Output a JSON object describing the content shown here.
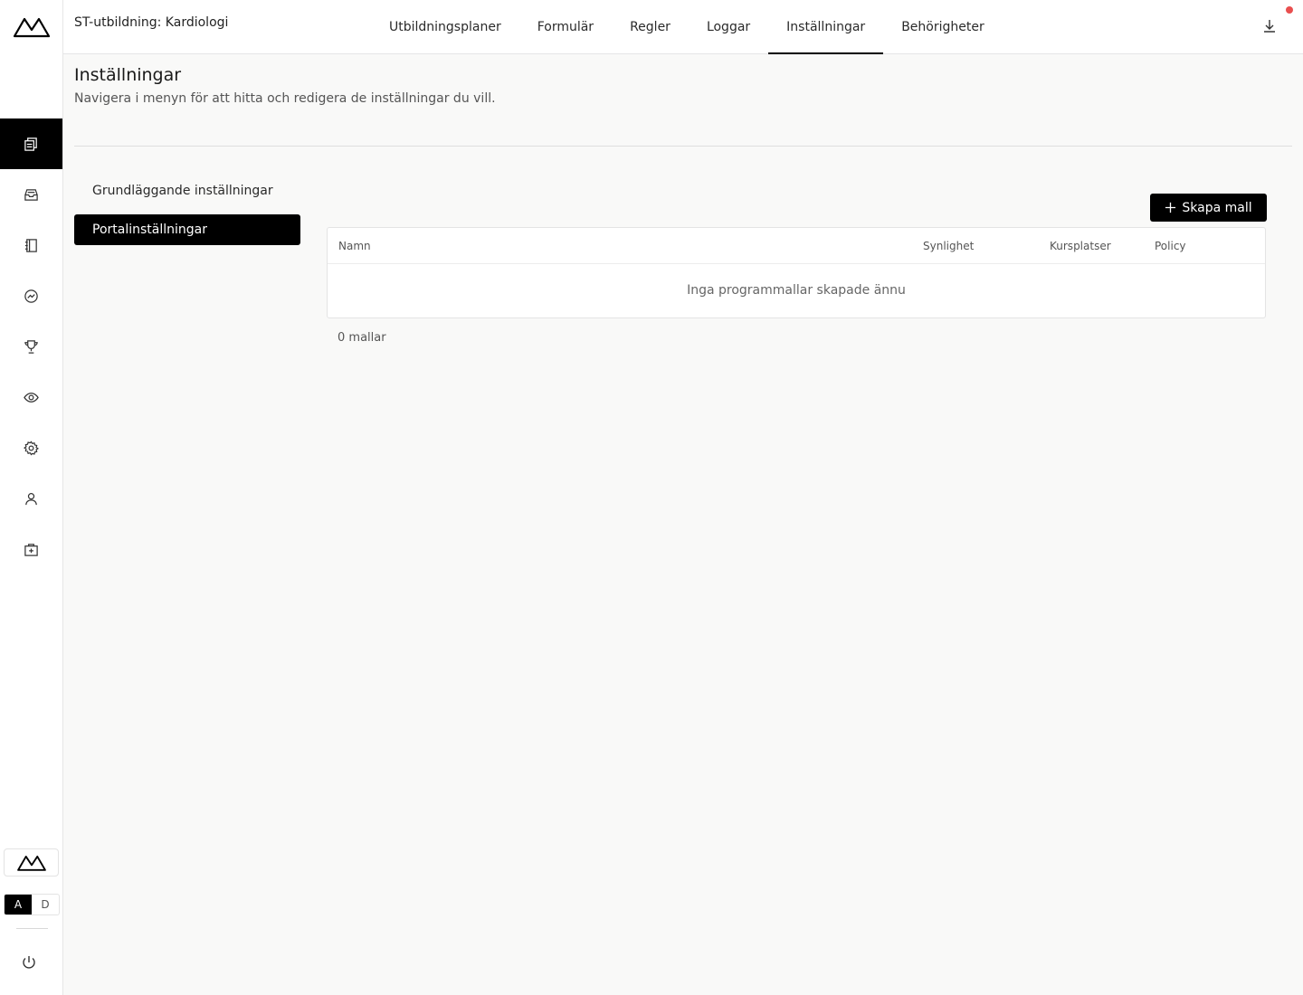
{
  "app": {
    "title": "ST-utbildning: Kardiologi"
  },
  "tabs": [
    {
      "label": "Utbildningsplaner"
    },
    {
      "label": "Formulär"
    },
    {
      "label": "Regler"
    },
    {
      "label": "Loggar"
    },
    {
      "label": "Inställningar"
    },
    {
      "label": "Behörigheter"
    }
  ],
  "active_tab": "Inställningar",
  "sidebar": {
    "icons": [
      "documents-icon",
      "inbox-icon",
      "notebook-icon",
      "progress-icon",
      "trophy-icon",
      "eye-icon",
      "gear-icon",
      "user-icon",
      "medical-kit-icon"
    ],
    "lang": {
      "a": "A",
      "d": "D"
    }
  },
  "header": {
    "title": "Inställningar",
    "subtitle": "Navigera i menyn för att hitta och redigera de inställningar du vill."
  },
  "submenu": {
    "items": [
      {
        "label": "Grundläggande inställningar"
      },
      {
        "label": "Portalinställningar"
      }
    ],
    "active": "Portalinställningar"
  },
  "create_button": {
    "label": "Skapa mall"
  },
  "table": {
    "columns": [
      "Namn",
      "Synlighet",
      "Kursplatser",
      "Policy"
    ],
    "rows": [],
    "empty_text": "Inga programmallar skapade ännu"
  },
  "count_text": "0 mallar",
  "colors": {
    "accent": "#000000",
    "notification": "#e94f4f",
    "background": "#f9f9f8"
  }
}
